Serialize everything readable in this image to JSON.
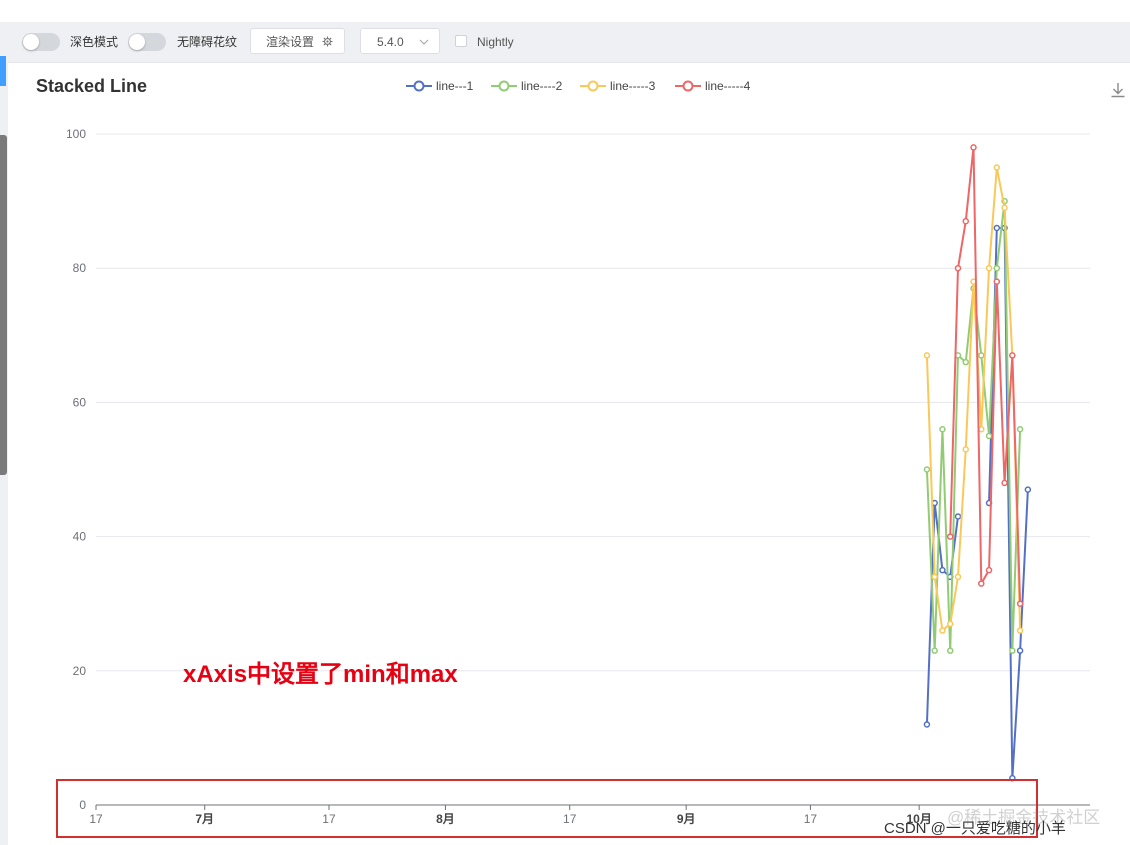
{
  "toolbar": {
    "dark_mode_label": "深色模式",
    "accessibility_label": "无障碍花纹",
    "render_settings_label": "渲染设置",
    "version_value": "5.4.0",
    "nightly_label": "Nightly"
  },
  "colors": {
    "line1": "#5470c6",
    "line2": "#91cc75",
    "line3": "#fac858",
    "line4": "#ee6666",
    "annotation": "#e60012",
    "accent": "#409eff"
  },
  "annotation_text": "xAxis中设置了min和max",
  "watermark_text": "@稀土掘金技术社区",
  "credit_text": "CSDN @一只爱吃糖的小羊",
  "chart_data": {
    "type": "line",
    "title": "Stacked Line",
    "legend": [
      "line---1",
      "line----2",
      "line-----3",
      "line-----4"
    ],
    "legend_position": "top-center",
    "xlabel": "",
    "ylabel": "",
    "ylim": [
      0,
      100
    ],
    "y_ticks": [
      "0",
      "20",
      "40",
      "60",
      "80",
      "100"
    ],
    "x_ticks": [
      "17",
      "7月",
      "17",
      "8月",
      "17",
      "9月",
      "17",
      "10月"
    ],
    "x_range": [
      "2022-06-17",
      "2022-10-23"
    ],
    "grid": true,
    "x": [
      "2022-10-02",
      "2022-10-03",
      "2022-10-04",
      "2022-10-05",
      "2022-10-06",
      "2022-10-07",
      "2022-10-08",
      "2022-10-09",
      "2022-10-10",
      "2022-10-11",
      "2022-10-12",
      "2022-10-13",
      "2022-10-14",
      "2022-10-15"
    ],
    "series": [
      {
        "name": "line---1",
        "values": [
          12,
          45,
          35,
          34,
          43,
          null,
          null,
          null,
          45,
          86,
          86,
          4,
          23,
          47
        ]
      },
      {
        "name": "line----2",
        "values": [
          50,
          23,
          56,
          23,
          67,
          66,
          77,
          67,
          55,
          80,
          90,
          23,
          56,
          null
        ]
      },
      {
        "name": "line-----3",
        "values": [
          67,
          34,
          26,
          27,
          34,
          53,
          78,
          56,
          80,
          95,
          89,
          67,
          26,
          null
        ]
      },
      {
        "name": "line-----4",
        "values": [
          null,
          null,
          null,
          40,
          80,
          87,
          98,
          33,
          35,
          78,
          48,
          67,
          30,
          null
        ]
      }
    ]
  }
}
